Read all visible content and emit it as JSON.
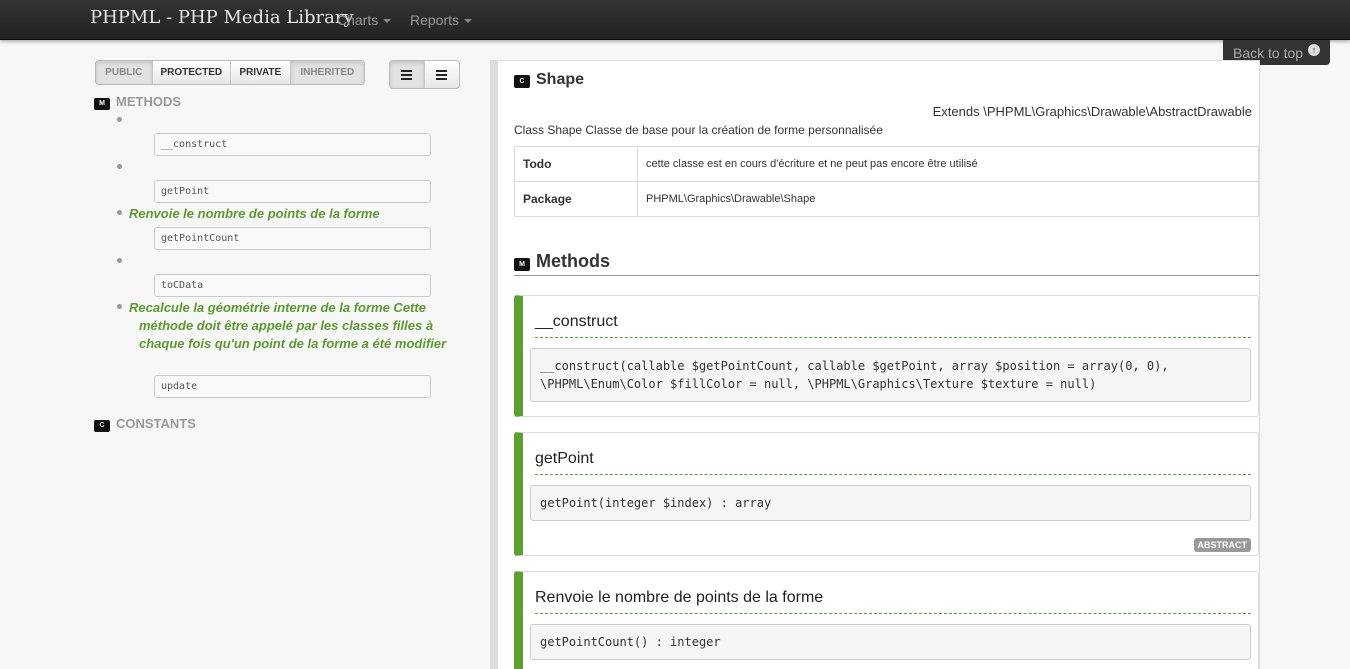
{
  "navbar": {
    "brand": "PHPML - PHP Media Library",
    "items": [
      {
        "label": "Charts"
      },
      {
        "label": "Reports"
      }
    ],
    "back_to_top": "Back to top"
  },
  "filters": {
    "public": "PUBLIC",
    "protected": "PROTECTED",
    "private": "PRIVATE",
    "inherited": "INHERITED"
  },
  "sidebar": {
    "methods_badge": "M",
    "methods_heading": "METHODS",
    "constants_badge": "C",
    "constants_heading": "CONSTANTS",
    "methods": [
      {
        "name": "__construct",
        "description": ""
      },
      {
        "name": "getPoint",
        "description": ""
      },
      {
        "name": "getPointCount",
        "description": "Renvoie le nombre de points de la forme"
      },
      {
        "name": "toCData",
        "description": ""
      },
      {
        "name": "update",
        "description_first": "Recalcule la géométrie interne de la forme Cette",
        "description_rest": "méthode doit être appelé par les classes filles à chaque fois qu'un point de la forme a été modifier"
      }
    ]
  },
  "main": {
    "class_badge": "C",
    "class_name": "Shape",
    "extends": "Extends \\PHPML\\Graphics\\Drawable\\AbstractDrawable",
    "description": "Class Shape Classe de base pour la création de forme personnalisée",
    "info": [
      {
        "key": "Todo",
        "value": "cette classe est en cours d'écriture et ne peut pas encore être utilisé"
      },
      {
        "key": "Package",
        "value": "PHPML\\Graphics\\Drawable\\Shape"
      }
    ],
    "methods_badge": "M",
    "methods_title": "Methods",
    "methods": [
      {
        "title": "__construct",
        "signature": "__construct(callable $getPointCount, callable $getPoint, array $position = array(0, 0), \\PHPML\\Enum\\Color $fillColor = null, \\PHPML\\Graphics\\Texture $texture = null)"
      },
      {
        "title": "getPoint",
        "signature": "getPoint(integer $index) : array",
        "tag": "ABSTRACT"
      },
      {
        "title": "Renvoie le nombre de points de la forme",
        "signature": "getPointCount() : integer"
      }
    ]
  }
}
